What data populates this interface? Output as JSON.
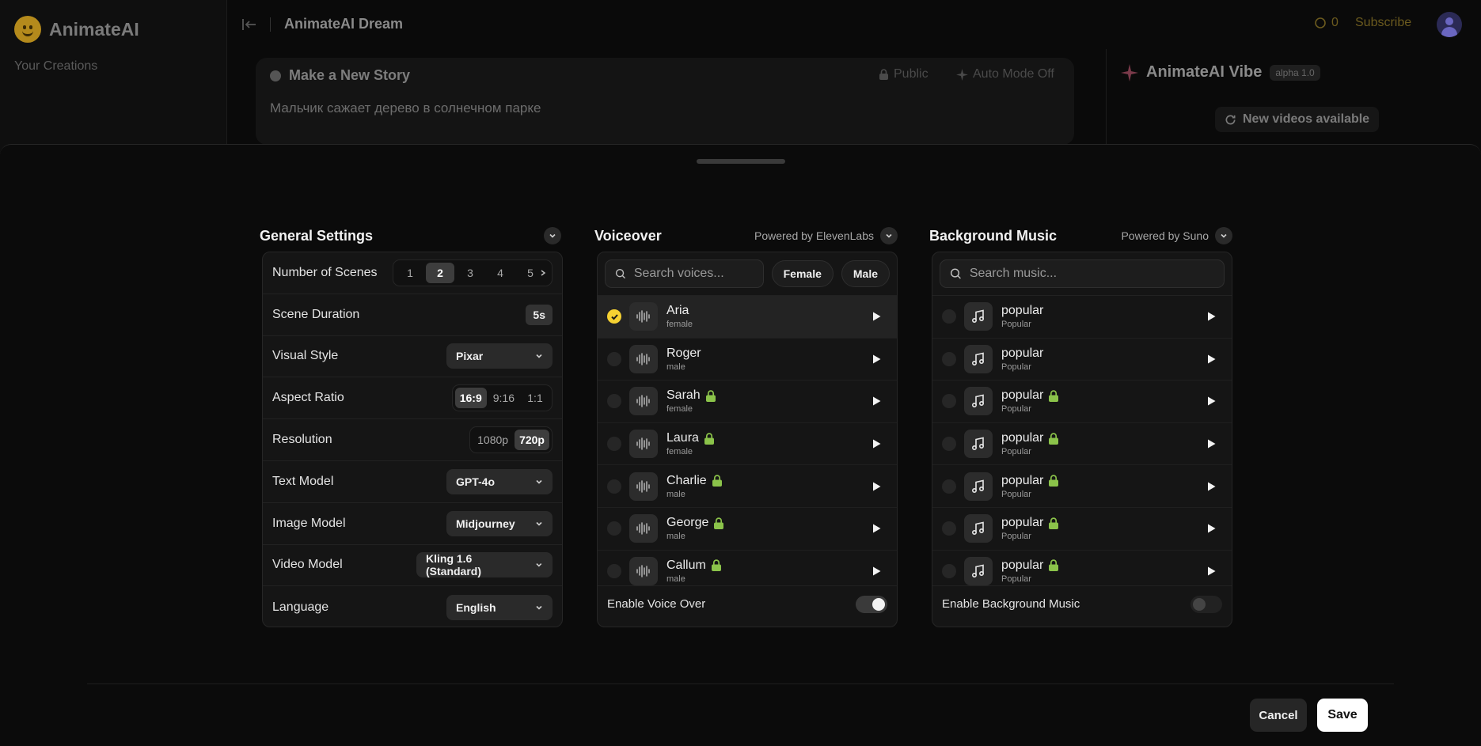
{
  "app": {
    "name": "AnimateAI",
    "sidebar_link": "Your Creations",
    "doc_title": "AnimateAI Dream",
    "credits": "0",
    "subscribe": "Subscribe"
  },
  "story": {
    "title": "Make a New Story",
    "public_label": "Public",
    "auto_mode_label": "Auto Mode Off",
    "prompt": "Мальчик сажает дерево в солнечном парке"
  },
  "vibe": {
    "title": "AnimateAI Vibe",
    "badge": "alpha 1.0",
    "new_videos": "New videos available"
  },
  "general": {
    "title": "General Settings",
    "scenes_label": "Number of Scenes",
    "scenes": [
      "1",
      "2",
      "3",
      "4",
      "5"
    ],
    "scenes_selected": "2",
    "duration_label": "Scene Duration",
    "duration": "5s",
    "visual_label": "Visual Style",
    "visual": "Pixar",
    "aspect_label": "Aspect Ratio",
    "aspects": [
      "16:9",
      "9:16",
      "1:1"
    ],
    "aspect_selected": "16:9",
    "resolution_label": "Resolution",
    "resolutions": [
      "1080p",
      "720p"
    ],
    "resolution_selected": "720p",
    "text_model_label": "Text Model",
    "text_model": "GPT-4o",
    "image_model_label": "Image Model",
    "image_model": "Midjourney",
    "video_model_label": "Video Model",
    "video_model": "Kling 1.6 (Standard)",
    "language_label": "Language",
    "language": "English"
  },
  "voiceover": {
    "title": "Voiceover",
    "powered_by": "Powered by ElevenLabs",
    "search_placeholder": "Search voices...",
    "filter_female": "Female",
    "filter_male": "Male",
    "voices": [
      {
        "name": "Aria",
        "gender": "female",
        "locked": false,
        "selected": true
      },
      {
        "name": "Roger",
        "gender": "male",
        "locked": false,
        "selected": false
      },
      {
        "name": "Sarah",
        "gender": "female",
        "locked": true,
        "selected": false
      },
      {
        "name": "Laura",
        "gender": "female",
        "locked": true,
        "selected": false
      },
      {
        "name": "Charlie",
        "gender": "male",
        "locked": true,
        "selected": false
      },
      {
        "name": "George",
        "gender": "male",
        "locked": true,
        "selected": false
      },
      {
        "name": "Callum",
        "gender": "male",
        "locked": true,
        "selected": false
      }
    ],
    "enable_label": "Enable Voice Over",
    "enabled": true
  },
  "music": {
    "title": "Background Music",
    "powered_by": "Powered by Suno",
    "search_placeholder": "Search music...",
    "tracks": [
      {
        "name": "popular",
        "genre": "Popular",
        "locked": false
      },
      {
        "name": "popular",
        "genre": "Popular",
        "locked": false
      },
      {
        "name": "popular",
        "genre": "Popular",
        "locked": true
      },
      {
        "name": "popular",
        "genre": "Popular",
        "locked": true
      },
      {
        "name": "popular",
        "genre": "Popular",
        "locked": true
      },
      {
        "name": "popular",
        "genre": "Popular",
        "locked": true
      },
      {
        "name": "popular",
        "genre": "Popular",
        "locked": true
      }
    ],
    "enable_label": "Enable Background Music",
    "enabled": false
  },
  "footer": {
    "cancel": "Cancel",
    "save": "Save"
  },
  "colors": {
    "accent_yellow": "#f6d232",
    "lock_green": "#8bc34a",
    "background": "#0b0b0b"
  },
  "icons": {
    "logo": "smiley-face-icon",
    "collapse": "collapse-sidebar-icon",
    "voice_thumb": "waveform-icon",
    "music_thumb": "music-note-icon",
    "play": "play-icon",
    "lock": "lock-icon",
    "search": "search-icon",
    "chevron": "chevron-down-icon"
  }
}
